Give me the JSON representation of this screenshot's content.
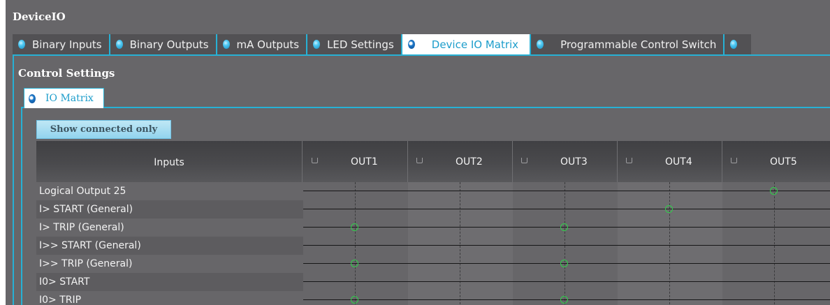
{
  "app": {
    "title": "DeviceIO"
  },
  "tabs": [
    {
      "label": "Binary Inputs",
      "active": false
    },
    {
      "label": "Binary Outputs",
      "active": false
    },
    {
      "label": "mA Outputs",
      "active": false
    },
    {
      "label": "LED Settings",
      "active": false
    },
    {
      "label": "Device IO Matrix",
      "active": true
    },
    {
      "label": "Programmable Control Switch",
      "active": false
    },
    {
      "label": "",
      "active": false
    }
  ],
  "section": {
    "title": "Control Settings",
    "subtab": "IO Matrix"
  },
  "toolbar": {
    "show_connected_label": "Show connected only"
  },
  "matrix": {
    "inputs_header": "Inputs",
    "columns": [
      "OUT1",
      "OUT2",
      "OUT3",
      "OUT4",
      "OUT5"
    ],
    "rows": [
      {
        "name": "Logical Output 25",
        "connections": [
          "OUT5"
        ]
      },
      {
        "name": "I> START (General)",
        "connections": [
          "OUT4"
        ]
      },
      {
        "name": "I> TRIP (General)",
        "connections": [
          "OUT1",
          "OUT3"
        ]
      },
      {
        "name": "I>> START (General)",
        "connections": []
      },
      {
        "name": "I>> TRIP (General)",
        "connections": [
          "OUT1",
          "OUT3"
        ]
      },
      {
        "name": "I0> START",
        "connections": []
      },
      {
        "name": "I0> TRIP",
        "connections": [
          "OUT1",
          "OUT3"
        ]
      }
    ]
  },
  "colors": {
    "accent": "#27b1d5",
    "node": "#2fd14a",
    "background": "#676669"
  }
}
